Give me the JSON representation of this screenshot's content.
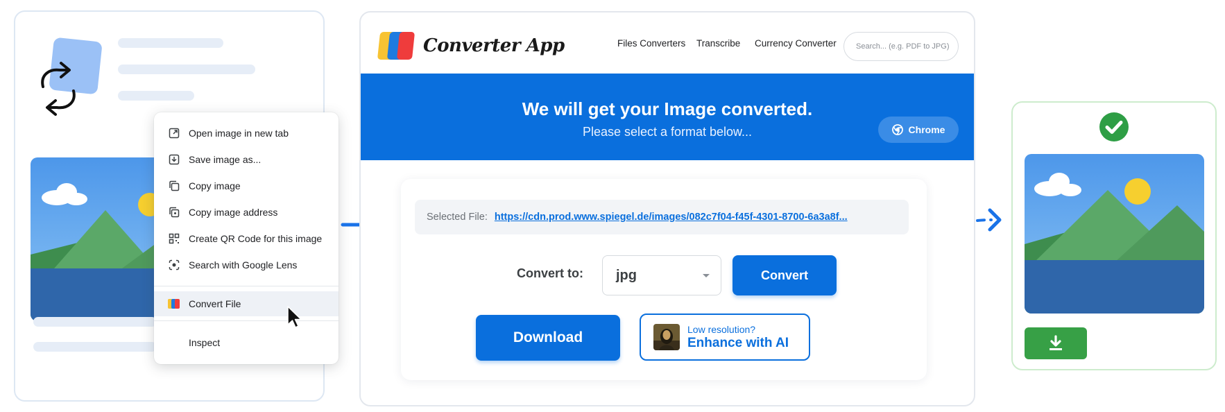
{
  "context_menu": {
    "items": [
      {
        "label": "Open image in new tab",
        "icon": "open-in-new-tab-icon"
      },
      {
        "label": "Save image as...",
        "icon": "save-icon"
      },
      {
        "label": "Copy image",
        "icon": "copy-icon"
      },
      {
        "label": "Copy image address",
        "icon": "copy-address-icon"
      },
      {
        "label": "Create QR Code for this image",
        "icon": "qr-code-icon"
      },
      {
        "label": "Search with Google Lens",
        "icon": "lens-icon"
      },
      {
        "label": "Convert File",
        "icon": "converter-app-icon"
      },
      {
        "label": "Inspect",
        "icon": ""
      }
    ],
    "highlighted_index": 6
  },
  "app": {
    "brand": "Converter App",
    "nav": [
      "Files Converters",
      "Transcribe",
      "Currency Converter"
    ],
    "search_placeholder": "Search... (e.g. PDF to JPG)",
    "banner_title": "We will get your Image converted.",
    "banner_subtitle": "Please select a format below...",
    "chrome_button": "Chrome",
    "selected_file_label": "Selected File:",
    "selected_file_url": "https://cdn.prod.www.spiegel.de/images/082c7f04-f45f-4301-8700-6a3a8f...",
    "convert_to_label": "Convert to:",
    "format_value": "jpg",
    "convert_button": "Convert",
    "download_button": "Download",
    "enhance_small": "Low resolution?",
    "enhance_big": "Enhance with AI"
  },
  "colors": {
    "primary_blue": "#0a6fdd",
    "success_green": "#37a046"
  }
}
